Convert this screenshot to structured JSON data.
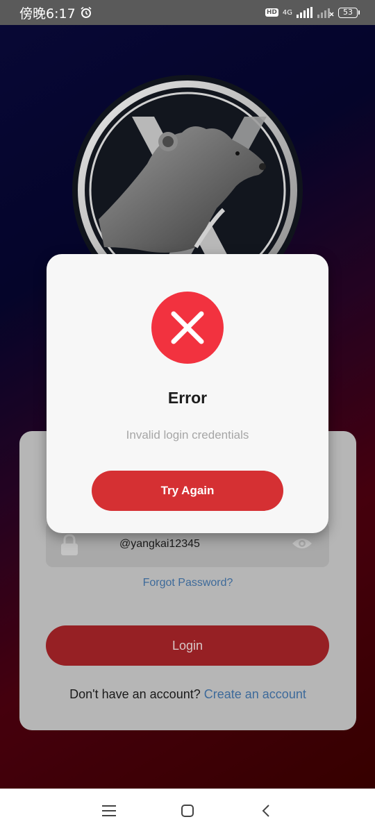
{
  "status_bar": {
    "time": "傍晚6:17",
    "network": "4G",
    "hd": "HD",
    "battery": "53"
  },
  "login": {
    "password_value": "@yangkai12345",
    "forgot_password": "Forgot Password?",
    "login_label": "Login",
    "signup_prompt": "Don't have an account?",
    "signup_link": "Create an account"
  },
  "dialog": {
    "title": "Error",
    "message": "Invalid login credentials",
    "button_label": "Try Again"
  },
  "icons": {
    "logo": "bear-x-logo",
    "error": "close-icon",
    "lock": "lock-icon",
    "eye": "eye-icon",
    "menu": "menu-icon",
    "home": "home-icon",
    "back": "back-icon"
  },
  "colors": {
    "error_red": "#f2323f",
    "button_red": "#d53033",
    "link_blue": "#3d6a9a"
  }
}
